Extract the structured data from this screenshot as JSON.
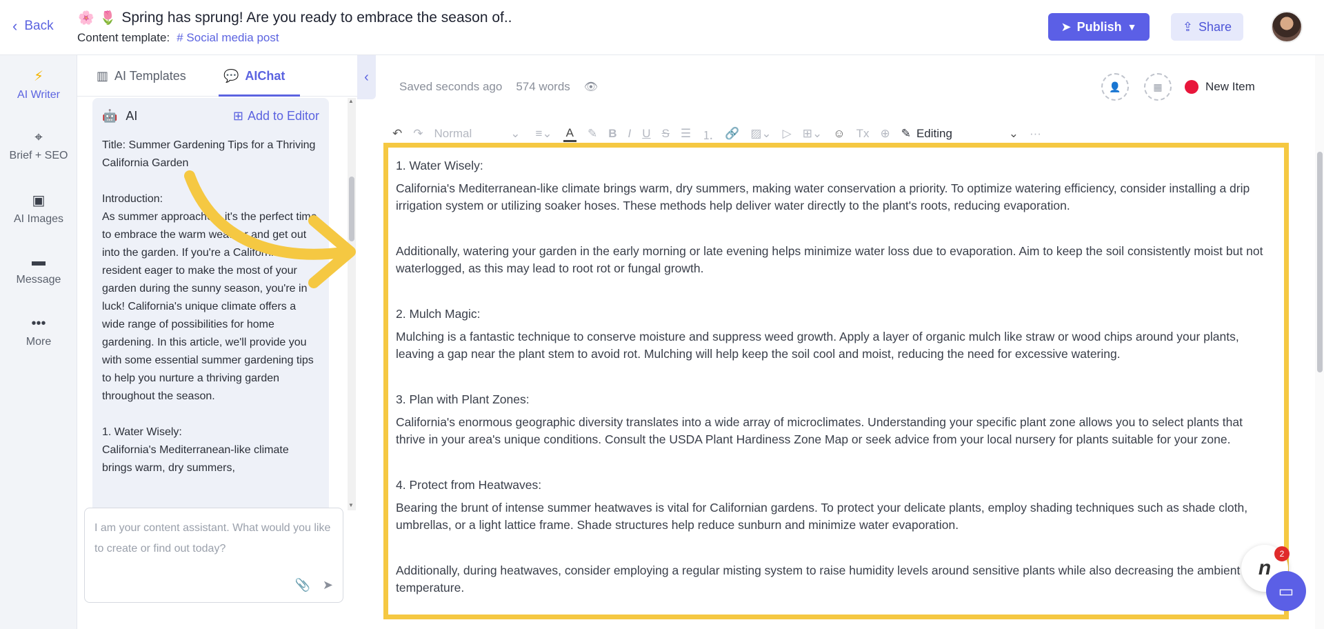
{
  "header": {
    "back_label": "Back",
    "emoji_1": "🌸",
    "emoji_2": "🌷",
    "title": "Spring has sprung! Are you ready to embrace the season of..",
    "template_label": "Content template:",
    "template_hash": "#",
    "template_name": "Social media post",
    "publish_label": "Publish",
    "share_label": "Share"
  },
  "rail": {
    "items": [
      {
        "label": "AI Writer",
        "icon": "lightning-icon"
      },
      {
        "label": "Brief + SEO",
        "icon": "crosshair-icon"
      },
      {
        "label": "AI Images",
        "icon": "image-icon"
      },
      {
        "label": "Message",
        "icon": "message-icon"
      },
      {
        "label": "More",
        "icon": "more-icon"
      }
    ]
  },
  "panel": {
    "tab_templates": "AI Templates",
    "tab_chat": "AIChat",
    "chat_sender": "AI",
    "add_to_editor": "Add to Editor",
    "messages": [
      "Title: Summer Gardening Tips for a Thriving California Garden",
      "Introduction:\nAs summer approaches, it's the perfect time to embrace the warm weather and get out into the garden. If you're a California resident eager to make the most of your garden during the sunny season, you're in luck! California's unique climate offers a wide range of possibilities for home gardening. In this article, we'll provide you with some essential summer gardening tips to help you nurture a thriving garden throughout the season.",
      "1. Water Wisely:\nCalifornia's Mediterranean-like climate brings warm, dry summers,"
    ],
    "input_placeholder": "I am your content assistant. What would you like to create or find out today?"
  },
  "editor": {
    "saved": "Saved seconds ago",
    "word_count": "574 words",
    "new_item": "New Item",
    "toolbar": {
      "style": "Normal",
      "mode": "Editing"
    },
    "content": [
      {
        "heading": "1. Water Wisely:",
        "para": "California's Mediterranean-like climate brings warm, dry summers, making water conservation a priority. To optimize watering efficiency, consider installing a drip irrigation system or utilizing soaker hoses. These methods help deliver water directly to the plant's roots, reducing evaporation."
      },
      {
        "heading": "",
        "para": "Additionally, watering your garden in the early morning or late evening helps minimize water loss due to evaporation. Aim to keep the soil consistently moist but not waterlogged, as this may lead to root rot or fungal growth."
      },
      {
        "heading": "2. Mulch Magic:",
        "para": "Mulching is a fantastic technique to conserve moisture and suppress weed growth. Apply a layer of organic mulch like straw or wood chips around your plants, leaving a gap near the plant stem to avoid rot. Mulching will help keep the soil cool and moist, reducing the need for excessive watering."
      },
      {
        "heading": "3. Plan with Plant Zones:",
        "para": "California's enormous geographic diversity translates into a wide array of microclimates. Understanding your specific plant zone allows you to select plants that thrive in your area's unique conditions. Consult the USDA Plant Hardiness Zone Map or seek advice from your local nursery for plants suitable for your zone."
      },
      {
        "heading": "4. Protect from Heatwaves:",
        "para": "Bearing the brunt of intense summer heatwaves is vital for Californian gardens. To protect your delicate plants, employ shading techniques such as shade cloth, umbrellas, or a light lattice frame. Shade structures help reduce sunburn and minimize water evaporation."
      },
      {
        "heading": "",
        "para": "Additionally, during heatwaves, consider employing a regular misting system to raise humidity levels around sensitive plants while also decreasing the ambient temperature."
      }
    ]
  },
  "widget": {
    "badge": "2",
    "logo": "n"
  },
  "colors": {
    "accent": "#5b5fe6",
    "highlight_frame": "#f5c842",
    "new_item_dot": "#e8163b"
  }
}
